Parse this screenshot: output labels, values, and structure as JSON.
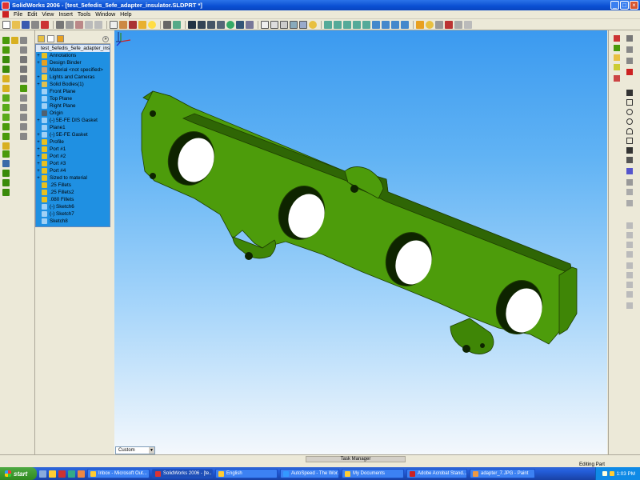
{
  "window": {
    "title": "SolidWorks 2006 - [test_5efedis_5efe_adapter_insulator.SLDPRT *]"
  },
  "menu": [
    "File",
    "Edit",
    "View",
    "Insert",
    "Tools",
    "Window",
    "Help"
  ],
  "feature_tree": {
    "root": "test_5efedis_5efe_adapter_insul",
    "items": [
      {
        "label": "Annotations",
        "expandable": true,
        "icon": "annotations-icon",
        "color": "#e8c020"
      },
      {
        "label": "Design Binder",
        "expandable": true,
        "icon": "design-binder-icon",
        "color": "#e8a020"
      },
      {
        "label": "Material <not specified>",
        "expandable": false,
        "icon": "material-icon",
        "color": "#c9a27a"
      },
      {
        "label": "Lights and Cameras",
        "expandable": true,
        "icon": "lights-icon",
        "color": "#f0d040"
      },
      {
        "label": "Solid Bodies(1)",
        "expandable": true,
        "icon": "solid-bodies-icon",
        "color": "#e0c050"
      },
      {
        "label": "Front Plane",
        "expandable": false,
        "icon": "plane-icon",
        "color": "#9fd0f5"
      },
      {
        "label": "Top Plane",
        "expandable": false,
        "icon": "plane-icon",
        "color": "#9fd0f5"
      },
      {
        "label": "Right Plane",
        "expandable": false,
        "icon": "plane-icon",
        "color": "#9fd0f5"
      },
      {
        "label": "Origin",
        "expandable": false,
        "icon": "origin-icon",
        "color": "#506070"
      },
      {
        "label": "(-) 5E-FE DIS Gasket",
        "expandable": true,
        "icon": "sketch-icon",
        "color": "#9fd0f5"
      },
      {
        "label": "Plane1",
        "expandable": false,
        "icon": "plane-icon",
        "color": "#9fd0f5"
      },
      {
        "label": "(-) 5E-FE Gasket",
        "expandable": true,
        "icon": "sketch-icon",
        "color": "#9fd0f5"
      },
      {
        "label": "Profile",
        "expandable": true,
        "icon": "extrude-icon",
        "color": "#e8c020"
      },
      {
        "label": "Port #1",
        "expandable": true,
        "icon": "cut-icon",
        "color": "#e8c020"
      },
      {
        "label": "Port #2",
        "expandable": true,
        "icon": "cut-icon",
        "color": "#e8c020"
      },
      {
        "label": "Port #3",
        "expandable": true,
        "icon": "cut-icon",
        "color": "#e8c020"
      },
      {
        "label": "Port #4",
        "expandable": true,
        "icon": "cut-icon",
        "color": "#e8c020"
      },
      {
        "label": "Sized to material",
        "expandable": true,
        "icon": "extrude-icon",
        "color": "#e8c020"
      },
      {
        "label": ".25 Fillets",
        "expandable": false,
        "icon": "fillet-icon",
        "color": "#e8c020"
      },
      {
        "label": ".25 Fillets2",
        "expandable": false,
        "icon": "fillet-icon",
        "color": "#e8c020"
      },
      {
        "label": ".080 Fillets",
        "expandable": false,
        "icon": "fillet-icon",
        "color": "#e8c020"
      },
      {
        "label": "(-) Sketch6",
        "expandable": false,
        "icon": "sketch-icon",
        "color": "#9fd0f5"
      },
      {
        "label": "(-) Sketch7",
        "expandable": false,
        "icon": "sketch-icon",
        "color": "#9fd0f5"
      },
      {
        "label": "Sketch8",
        "expandable": false,
        "icon": "sketch-icon",
        "color": "#9fd0f5"
      }
    ]
  },
  "configuration": {
    "value": "Custom"
  },
  "status": {
    "task_manager": "Task Manager",
    "editing": "Editing Part"
  },
  "taskbar": {
    "start": "start",
    "tasks": [
      {
        "label": "Inbox - Microsoft Out...",
        "icon": "outlook-icon",
        "active": false
      },
      {
        "label": "SolidWorks 2006 - [te...",
        "icon": "solidworks-icon",
        "active": true
      },
      {
        "label": "English",
        "icon": "folder-icon",
        "active": false
      },
      {
        "label": "AutoSpeed - The Wor...",
        "icon": "browser-icon",
        "active": false
      },
      {
        "label": "My Documents",
        "icon": "folder-icon",
        "active": false
      },
      {
        "label": "Adobe Acrobat Stand...",
        "icon": "acrobat-icon",
        "active": false
      },
      {
        "label": "adapter_7.JPG - Paint",
        "icon": "paint-icon",
        "active": false
      }
    ],
    "clock": "1:03 PM"
  },
  "colors": {
    "part": "#4a9a0a",
    "part_dark": "#2f6605",
    "graphics_top": "#3b9af0",
    "tree_bg": "#1f90e2"
  }
}
